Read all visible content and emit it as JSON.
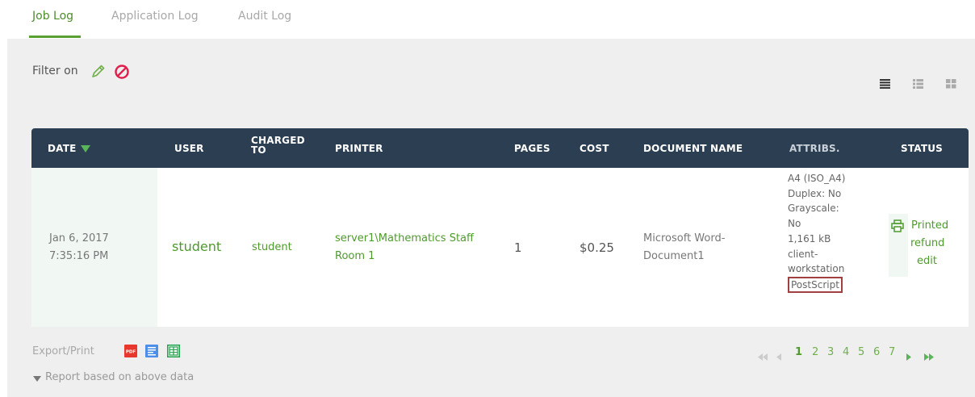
{
  "tabs": [
    {
      "label": "Job Log",
      "active": true
    },
    {
      "label": "Application Log",
      "active": false
    },
    {
      "label": "Audit Log",
      "active": false
    }
  ],
  "filter": {
    "label": "Filter on"
  },
  "icons": {
    "filter_edit": "pencil-icon",
    "filter_clear": "clear-filter-icon",
    "view_list": "list-view-icon",
    "view_details": "detail-view-icon",
    "view_grid": "grid-view-icon",
    "printer": "printer-icon"
  },
  "colors": {
    "accent": "#4e9a2c",
    "header_bg": "#2b3e52",
    "panel_bg": "#efefef",
    "highlight_border": "#a04040"
  },
  "table": {
    "columns": [
      "DATE",
      "USER",
      "CHARGED TO",
      "PRINTER",
      "PAGES",
      "COST",
      "DOCUMENT NAME",
      "ATTRIBS.",
      "STATUS"
    ],
    "charged_to_line1": "CHARGED",
    "charged_to_line2": "TO",
    "row": {
      "date": "Jan 6, 2017",
      "time": "7:35:16 PM",
      "user": "student",
      "charged_to": "student",
      "printer_line1": "server1\\Mathematics Staff",
      "printer_line2": "Room 1",
      "pages": "1",
      "cost": "$0.25",
      "document_line1": "Microsoft Word-",
      "document_line2": "Document1",
      "attribs": [
        "A4 (ISO_A4)",
        "Duplex: No",
        "Grayscale:",
        "No",
        "1,161 kB",
        "client-",
        "workstation"
      ],
      "attrib_highlighted": "PostScript",
      "status": "Printed",
      "actions": [
        "refund",
        "edit"
      ]
    }
  },
  "footer": {
    "export_label": "Export/Print",
    "export_icons": [
      "pdf-icon",
      "csv-icon",
      "excel-icon"
    ],
    "pdf_text": "PDF",
    "report_label": "Report based on above data"
  },
  "pagination": {
    "current": "1",
    "pages": [
      "1",
      "2",
      "3",
      "4",
      "5",
      "6",
      "7"
    ]
  }
}
